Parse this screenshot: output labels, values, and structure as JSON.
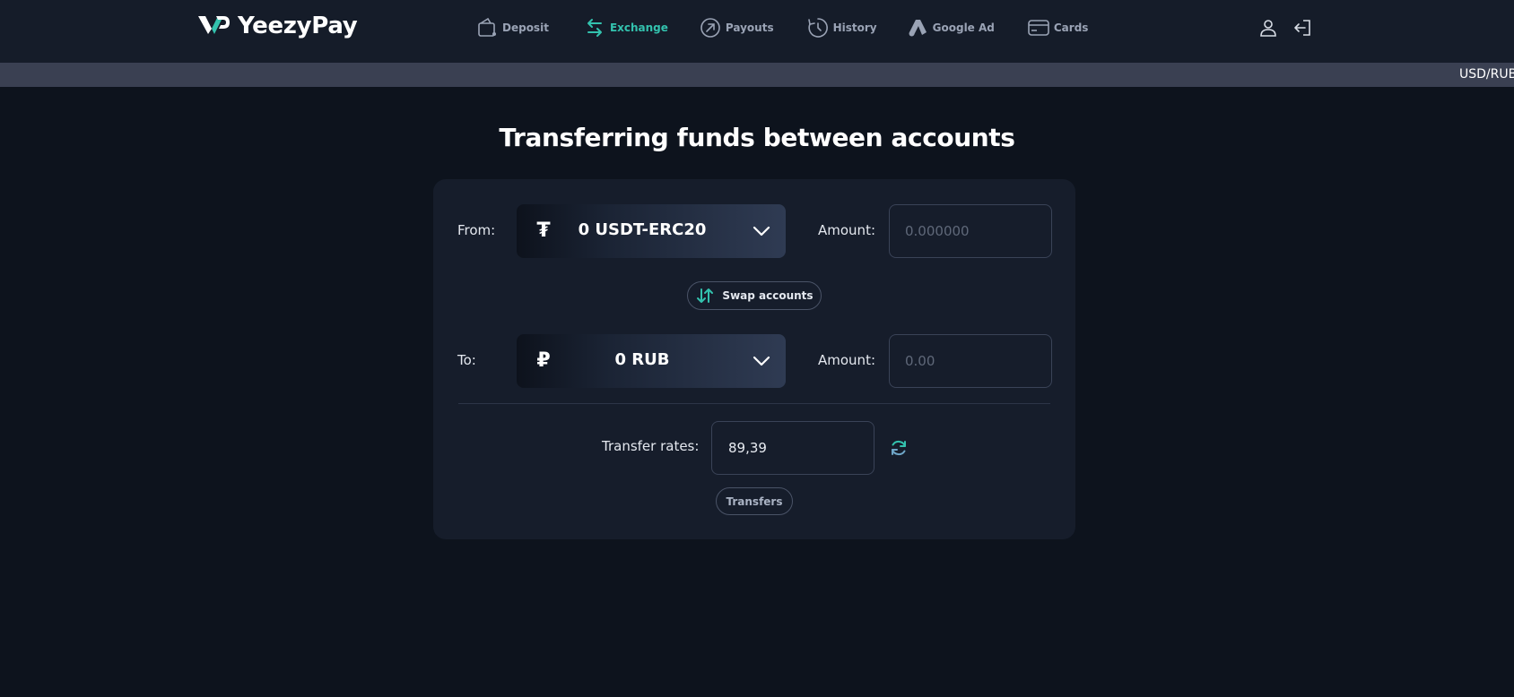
{
  "header": {
    "brand": "YeezyPay",
    "nav": [
      {
        "label": "Deposit",
        "icon": "wallet-icon",
        "active": false
      },
      {
        "label": "Exchange",
        "icon": "exchange-arrows-icon",
        "active": true
      },
      {
        "label": "Payouts",
        "icon": "arrow-up-right-circle-icon",
        "active": false
      },
      {
        "label": "History",
        "icon": "history-clock-icon",
        "active": false
      },
      {
        "label": "Google Ad",
        "icon": "google-ads-icon",
        "active": false
      },
      {
        "label": "Cards",
        "icon": "credit-card-icon",
        "active": false
      }
    ],
    "icons": [
      "user-icon",
      "logout-icon"
    ]
  },
  "ticker": {
    "text": "USD/RUB"
  },
  "page": {
    "title": "Transferring funds between accounts"
  },
  "form": {
    "from_label": "From:",
    "from_currency_icon": "₮",
    "from_account": "0 USDT-ERC20",
    "to_label": "To:",
    "to_currency_icon": "₽",
    "to_account": "0 RUB",
    "amount_label": "Amount:",
    "from_amount_placeholder": "0.000000",
    "to_amount_placeholder": "0.00",
    "swap_label": "Swap accounts",
    "rate_label": "Transfer rates:",
    "rate_value": "89,39",
    "transfers_label": "Transfers"
  },
  "colors": {
    "accent": "#33c2ae",
    "background": "#0d131d",
    "header": "#151c29",
    "card": "#161d2b",
    "ticker": "#3a4052"
  }
}
